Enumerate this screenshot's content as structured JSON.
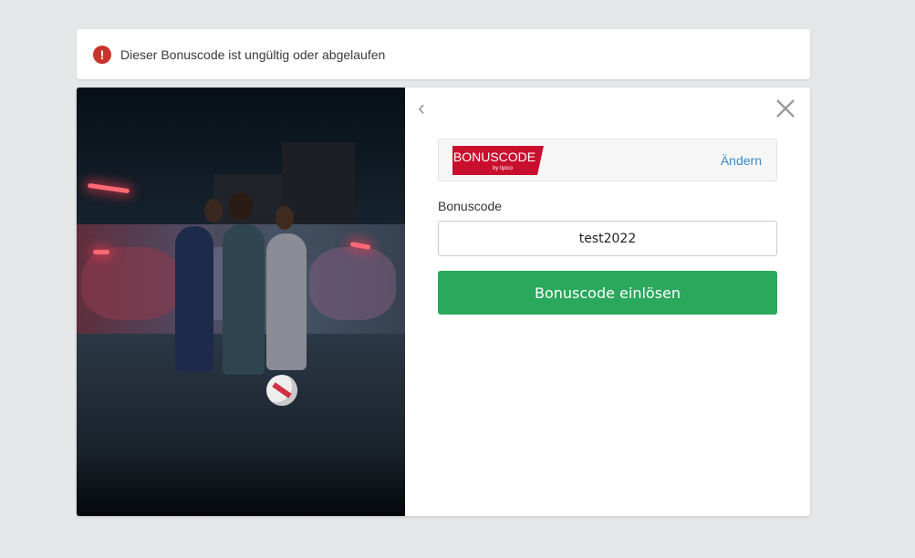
{
  "alert": {
    "icon": "error-exclamation-icon",
    "icon_glyph": "!",
    "message": "Dieser Bonuscode ist ungültig oder abgelaufen"
  },
  "modal": {
    "back_icon": "chevron-left-icon",
    "back_glyph": "‹",
    "close_icon": "close-icon",
    "bonus_card": {
      "logo_text": "BONUSCODE",
      "logo_subtext": "by tipico",
      "change_label": "Ändern"
    },
    "form": {
      "code_label": "Bonuscode",
      "code_value": "test2022",
      "submit_label": "Bonuscode einlösen"
    }
  },
  "colors": {
    "background": "#e6e7e9",
    "error": "#c8342b",
    "logo_red": "#c8102e",
    "link": "#3b8bbf",
    "button_green": "#2aa85c"
  }
}
